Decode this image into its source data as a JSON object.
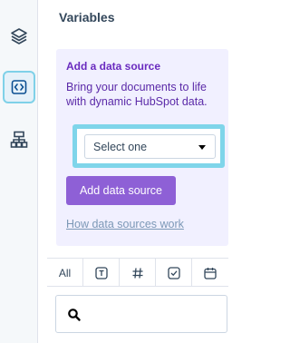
{
  "rail": {
    "items": [
      {
        "icon": "layers-icon"
      },
      {
        "icon": "code-brackets-icon",
        "active": true
      },
      {
        "icon": "sitemap-icon"
      }
    ]
  },
  "panel": {
    "title": "Variables"
  },
  "data_source_card": {
    "heading": "Add a data source",
    "body": "Bring your documents to life with dynamic HubSpot data.",
    "select": {
      "placeholder": "Select one"
    },
    "add_button_label": "Add data source",
    "help_link_label": "How data sources work"
  },
  "tabs": [
    {
      "label": "All",
      "icon": ""
    },
    {
      "label": "",
      "icon": "text-icon"
    },
    {
      "label": "",
      "icon": "hash-icon"
    },
    {
      "label": "",
      "icon": "checkbox-icon"
    },
    {
      "label": "",
      "icon": "calendar-icon"
    }
  ],
  "search": {
    "placeholder": ""
  },
  "colors": {
    "card_bg": "#f1f0ff",
    "heading": "#6a2bbf",
    "button": "#8e60d6",
    "highlight": "#7fd5ea",
    "link": "#7c98b6"
  }
}
